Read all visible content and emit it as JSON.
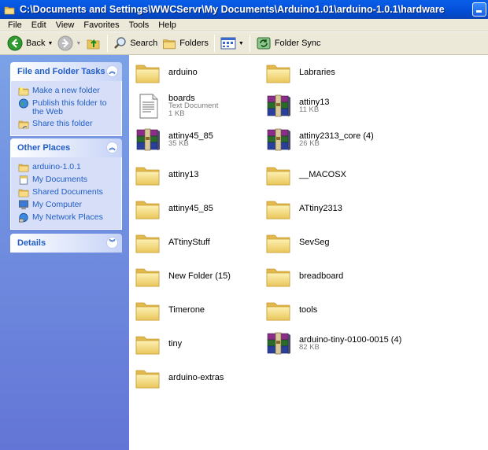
{
  "window": {
    "title": "C:\\Documents and Settings\\WWCServr\\My Documents\\Arduino1.01\\arduino-1.0.1\\hardware"
  },
  "menu": [
    "File",
    "Edit",
    "View",
    "Favorites",
    "Tools",
    "Help"
  ],
  "toolbar": {
    "back_label": "Back",
    "search_label": "Search",
    "folders_label": "Folders",
    "folder_sync_label": "Folder Sync"
  },
  "taskpane": {
    "file_tasks": {
      "title": "File and Folder Tasks",
      "items": [
        {
          "label": "Make a new folder",
          "icon": "new-folder-icon"
        },
        {
          "label": "Publish this folder to the Web",
          "icon": "globe-icon"
        },
        {
          "label": "Share this folder",
          "icon": "share-folder-icon"
        }
      ]
    },
    "other_places": {
      "title": "Other Places",
      "items": [
        {
          "label": "arduino-1.0.1",
          "icon": "folder-icon"
        },
        {
          "label": "My Documents",
          "icon": "my-documents-icon"
        },
        {
          "label": "Shared Documents",
          "icon": "shared-documents-icon"
        },
        {
          "label": "My Computer",
          "icon": "my-computer-icon"
        },
        {
          "label": "My Network Places",
          "icon": "network-places-icon"
        }
      ]
    },
    "details": {
      "title": "Details"
    }
  },
  "files": [
    {
      "name": "arduino",
      "type": "folder"
    },
    {
      "name": "Labraries",
      "type": "folder"
    },
    {
      "name": "boards",
      "type": "text",
      "desc": "Text Document",
      "size": "1 KB"
    },
    {
      "name": "attiny13",
      "type": "archive",
      "size": "11 KB"
    },
    {
      "name": "attiny45_85",
      "type": "archive",
      "size": "35 KB"
    },
    {
      "name": "attiny2313_core (4)",
      "type": "archive",
      "size": "26 KB"
    },
    {
      "name": "attiny13",
      "type": "folder"
    },
    {
      "name": "__MACOSX",
      "type": "folder"
    },
    {
      "name": "attiny45_85",
      "type": "folder"
    },
    {
      "name": "ATtiny2313",
      "type": "folder"
    },
    {
      "name": "ATtinyStuff",
      "type": "folder"
    },
    {
      "name": "SevSeg",
      "type": "folder"
    },
    {
      "name": "New Folder (15)",
      "type": "folder"
    },
    {
      "name": "breadboard",
      "type": "folder"
    },
    {
      "name": "Timerone",
      "type": "folder"
    },
    {
      "name": "tools",
      "type": "folder"
    },
    {
      "name": "tiny",
      "type": "folder"
    },
    {
      "name": "arduino-tiny-0100-0015 (4)",
      "type": "archive",
      "size": "82 KB"
    },
    {
      "name": "arduino-extras",
      "type": "folder"
    }
  ]
}
